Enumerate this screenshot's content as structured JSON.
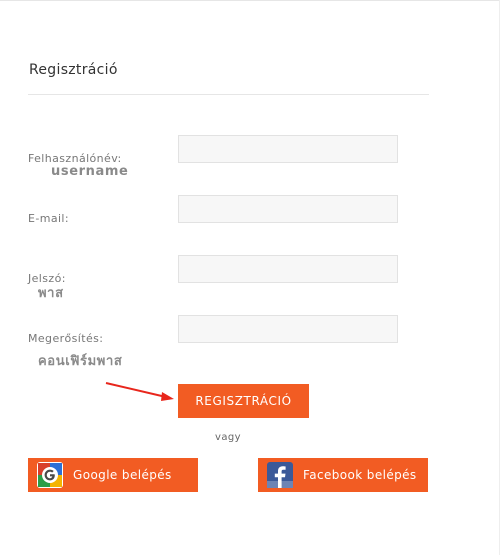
{
  "form": {
    "title": "Regisztráció",
    "fields": [
      {
        "label": "Felhasználónév:",
        "annotation": "username",
        "value": ""
      },
      {
        "label": "E-mail:",
        "value": ""
      },
      {
        "label": "Jelszó:",
        "annotation": "พาส",
        "value": ""
      },
      {
        "label": "Megerősítés:",
        "annotation": "คอนเฟิร์มพาส",
        "value": ""
      }
    ],
    "submit_label": "REGISZTRÁCIÓ",
    "or_text": "vagy"
  },
  "social": {
    "google_label": "Google belépés",
    "facebook_label": "Facebook belépés"
  },
  "colors": {
    "accent": "#f25c23",
    "annotation_arrow": "#e8261c",
    "facebook_blue": "#3b5998"
  },
  "icons": {
    "google": "google-icon",
    "facebook": "facebook-icon"
  }
}
